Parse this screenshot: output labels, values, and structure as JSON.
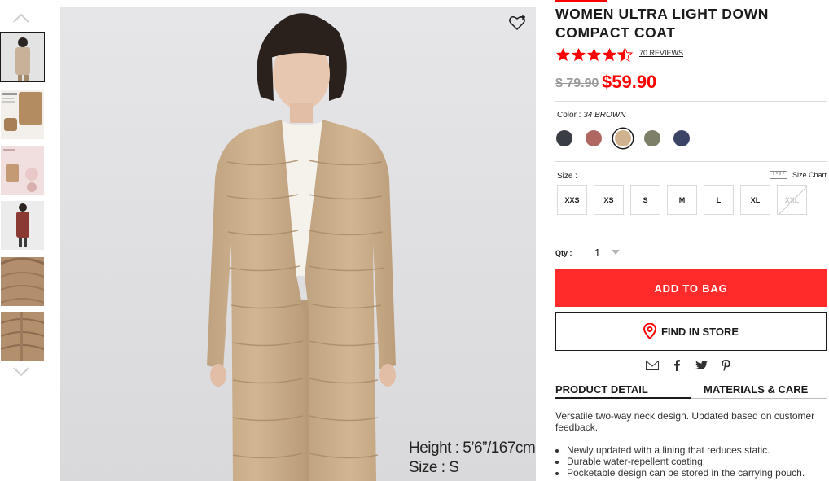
{
  "thumbnails": {
    "up_icon": "chevron-up-icon",
    "down_icon": "chevron-down-icon",
    "items": [
      {
        "name": "front-view",
        "tint": "#c7b8a3"
      },
      {
        "name": "infographic-compact",
        "tint": "#b99270"
      },
      {
        "name": "infographic-features",
        "tint": "#e7cfc8"
      },
      {
        "name": "model-dark",
        "tint": "#8a3a32"
      },
      {
        "name": "collar-detail",
        "tint": "#a98668"
      },
      {
        "name": "quilting-detail",
        "tint": "#b08c6c"
      }
    ]
  },
  "main_image": {
    "caption_height": "Height : 5’6”/167cm",
    "caption_size": "Size : S",
    "favorite_icon": "heart-plus-icon"
  },
  "product": {
    "title_line1": "WOMEN ULTRA LIGHT DOWN",
    "title_line2": "COMPACT COAT",
    "rating": 4.5,
    "reviews": "70 REVIEWS",
    "price_old": "$ 79.90",
    "price_new": "$59.90"
  },
  "color": {
    "label": "Color :",
    "selected": "34 BROWN",
    "swatches": [
      {
        "name": "dark-gray",
        "hex": "#3b3d44"
      },
      {
        "name": "wine",
        "hex": "#b06661"
      },
      {
        "name": "brown",
        "hex": "#d1b28f",
        "selected": true
      },
      {
        "name": "olive",
        "hex": "#7e7f68"
      },
      {
        "name": "navy",
        "hex": "#3b4467"
      }
    ]
  },
  "size": {
    "label": "Size :",
    "chart_label": "Size Chart",
    "options": [
      {
        "label": "XXS",
        "available": true
      },
      {
        "label": "XS",
        "available": true
      },
      {
        "label": "S",
        "available": true
      },
      {
        "label": "M",
        "available": true
      },
      {
        "label": "L",
        "available": true
      },
      {
        "label": "XL",
        "available": true
      },
      {
        "label": "XXL",
        "available": false
      }
    ]
  },
  "quantity": {
    "label": "Qty :",
    "value": "1"
  },
  "actions": {
    "add_to_bag": "ADD TO BAG",
    "find_in_store": "FIND IN STORE"
  },
  "share": [
    "mail-icon",
    "facebook-icon",
    "twitter-icon",
    "pinterest-icon"
  ],
  "tabs": {
    "product_detail": "PRODUCT DETAIL",
    "materials_care": "MATERIALS & CARE"
  },
  "detail": {
    "summary": "Versatile two-way neck design. Updated based on customer feedback.",
    "bullets": [
      "Newly updated with a lining that reduces static.",
      "Durable water-repellent coating.",
      "Pocketable design can be stored in the carrying pouch."
    ]
  },
  "colors": {
    "accent": "#ff0000",
    "button": "#ff2a2a",
    "star": "#ff0000"
  }
}
